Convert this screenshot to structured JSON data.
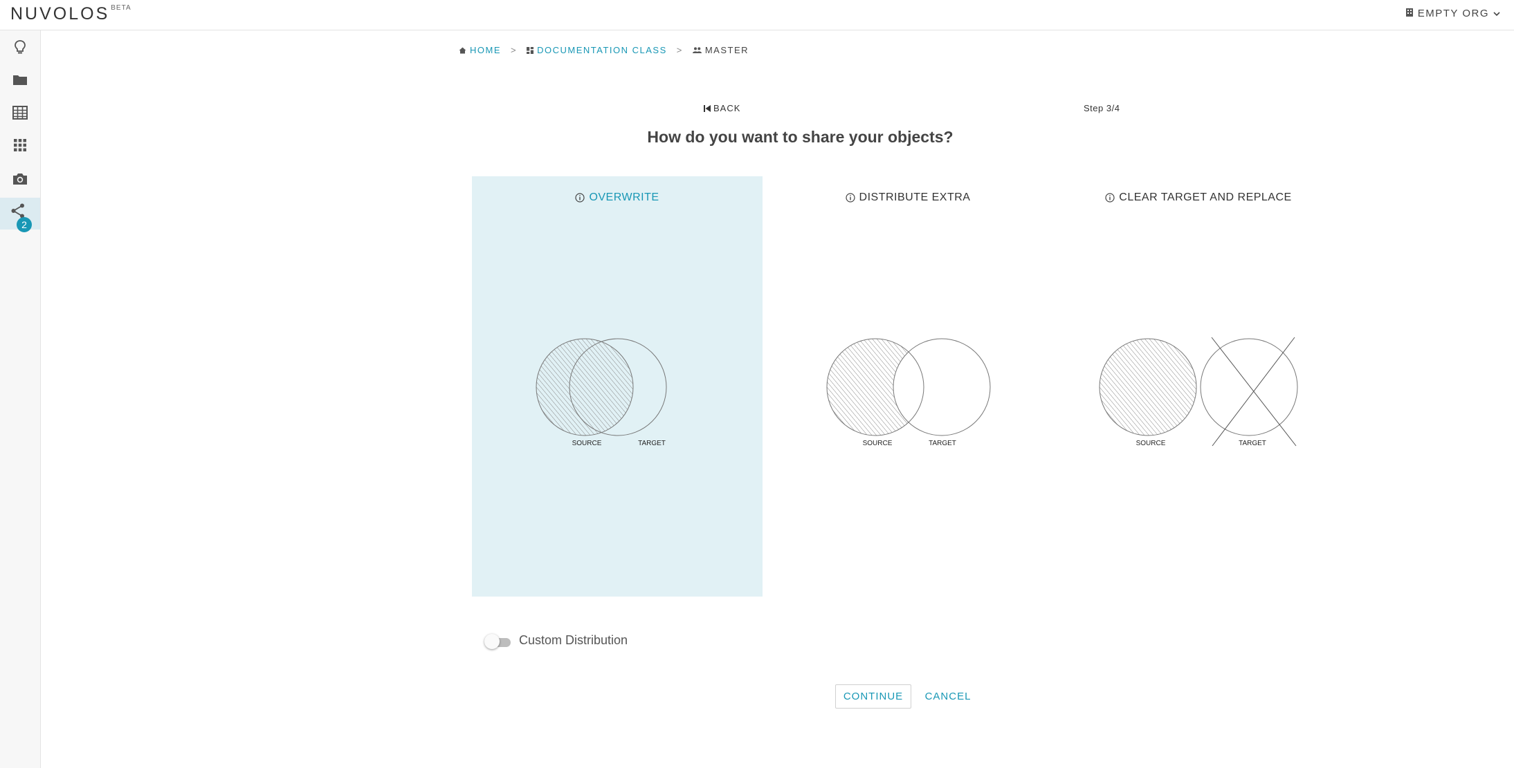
{
  "app": {
    "brand": "NUVOLOS",
    "brand_tag": "BETA",
    "org_name": "EMPTY ORG"
  },
  "sidebar": {
    "items": [
      {
        "icon": "lightbulb-icon"
      },
      {
        "icon": "folder-icon"
      },
      {
        "icon": "table-icon"
      },
      {
        "icon": "apps-grid-icon"
      },
      {
        "icon": "camera-icon"
      },
      {
        "icon": "share-icon",
        "badge": "2",
        "active": true
      }
    ]
  },
  "breadcrumb": {
    "home": "HOME",
    "class": "DOCUMENTATION CLASS",
    "instance": "MASTER",
    "separator": ">"
  },
  "wizard": {
    "back_label": "BACK",
    "step_label": "Step 3/4",
    "question": "How do you want to share your objects?",
    "options": [
      {
        "label": "OVERWRITE",
        "source": "SOURCE",
        "target": "TARGET",
        "selected": true
      },
      {
        "label": "DISTRIBUTE EXTRA",
        "source": "SOURCE",
        "target": "TARGET",
        "selected": false
      },
      {
        "label": "CLEAR TARGET AND REPLACE",
        "source": "SOURCE",
        "target": "TARGET",
        "selected": false
      }
    ],
    "custom_distribution_label": "Custom Distribution",
    "custom_distribution_enabled": false,
    "continue_label": "CONTINUE",
    "cancel_label": "CANCEL"
  },
  "colors": {
    "accent": "#1897b5",
    "selected_bg": "#e1f1f5",
    "sidebar_bg": "#f7f7f7"
  }
}
